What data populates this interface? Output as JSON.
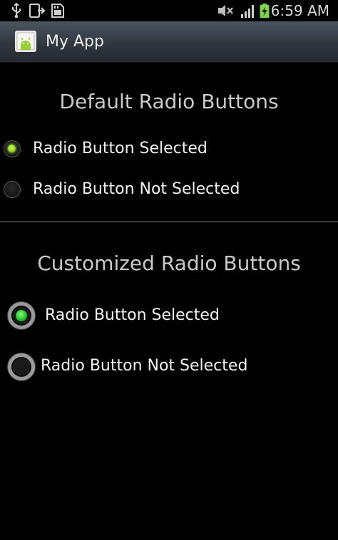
{
  "status_bar": {
    "time": "6:59 AM",
    "icons": [
      "usb-icon",
      "download-icon",
      "sd-card-icon",
      "mute-icon",
      "signal-icon",
      "battery-charging-icon"
    ]
  },
  "action_bar": {
    "title": "My App",
    "icon": "android-app-icon"
  },
  "default_section": {
    "title": "Default Radio Buttons",
    "options": [
      {
        "label": "Radio Button Selected",
        "checked": true
      },
      {
        "label": "Radio Button Not Selected",
        "checked": false
      }
    ]
  },
  "custom_section": {
    "title": "Customized Radio Buttons",
    "options": [
      {
        "label": "Radio Button Selected",
        "checked": true
      },
      {
        "label": "Radio Button Not Selected",
        "checked": false
      }
    ]
  },
  "colors": {
    "default_dot": "#8ed21a",
    "custom_dot": "#1fbe2a",
    "custom_ring": "#9a9a9a"
  }
}
